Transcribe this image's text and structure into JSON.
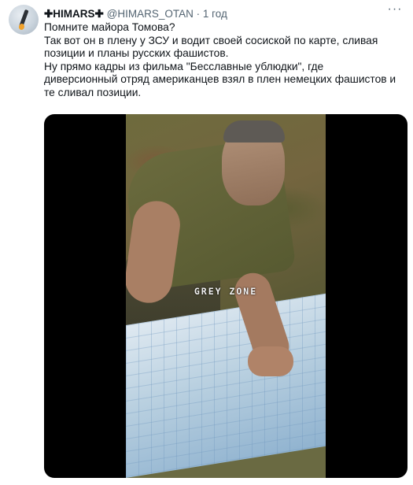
{
  "author": {
    "name": "✚HIMARS✚",
    "handle": "@HIMARS_OTAN",
    "separator": "·",
    "time": "1 год"
  },
  "more_icon": "more-horizontal-icon",
  "tweet_text": [
    "Помните майора Томова?",
    "Так вот он в плену у ЗСУ и водит своей сосиской по карте, сливая позиции и планы русских фашистов.",
    "Ну прямо кадры из фильма \"Бесславные ублюдки\", где диверсионный отряд американцев взял в плен немецких фашистов и те сливал позиции."
  ],
  "media": {
    "watermark": "GREY ZONE"
  },
  "colors": {
    "text": "#0f1419",
    "secondary": "#536471",
    "media_background": "#000000"
  }
}
